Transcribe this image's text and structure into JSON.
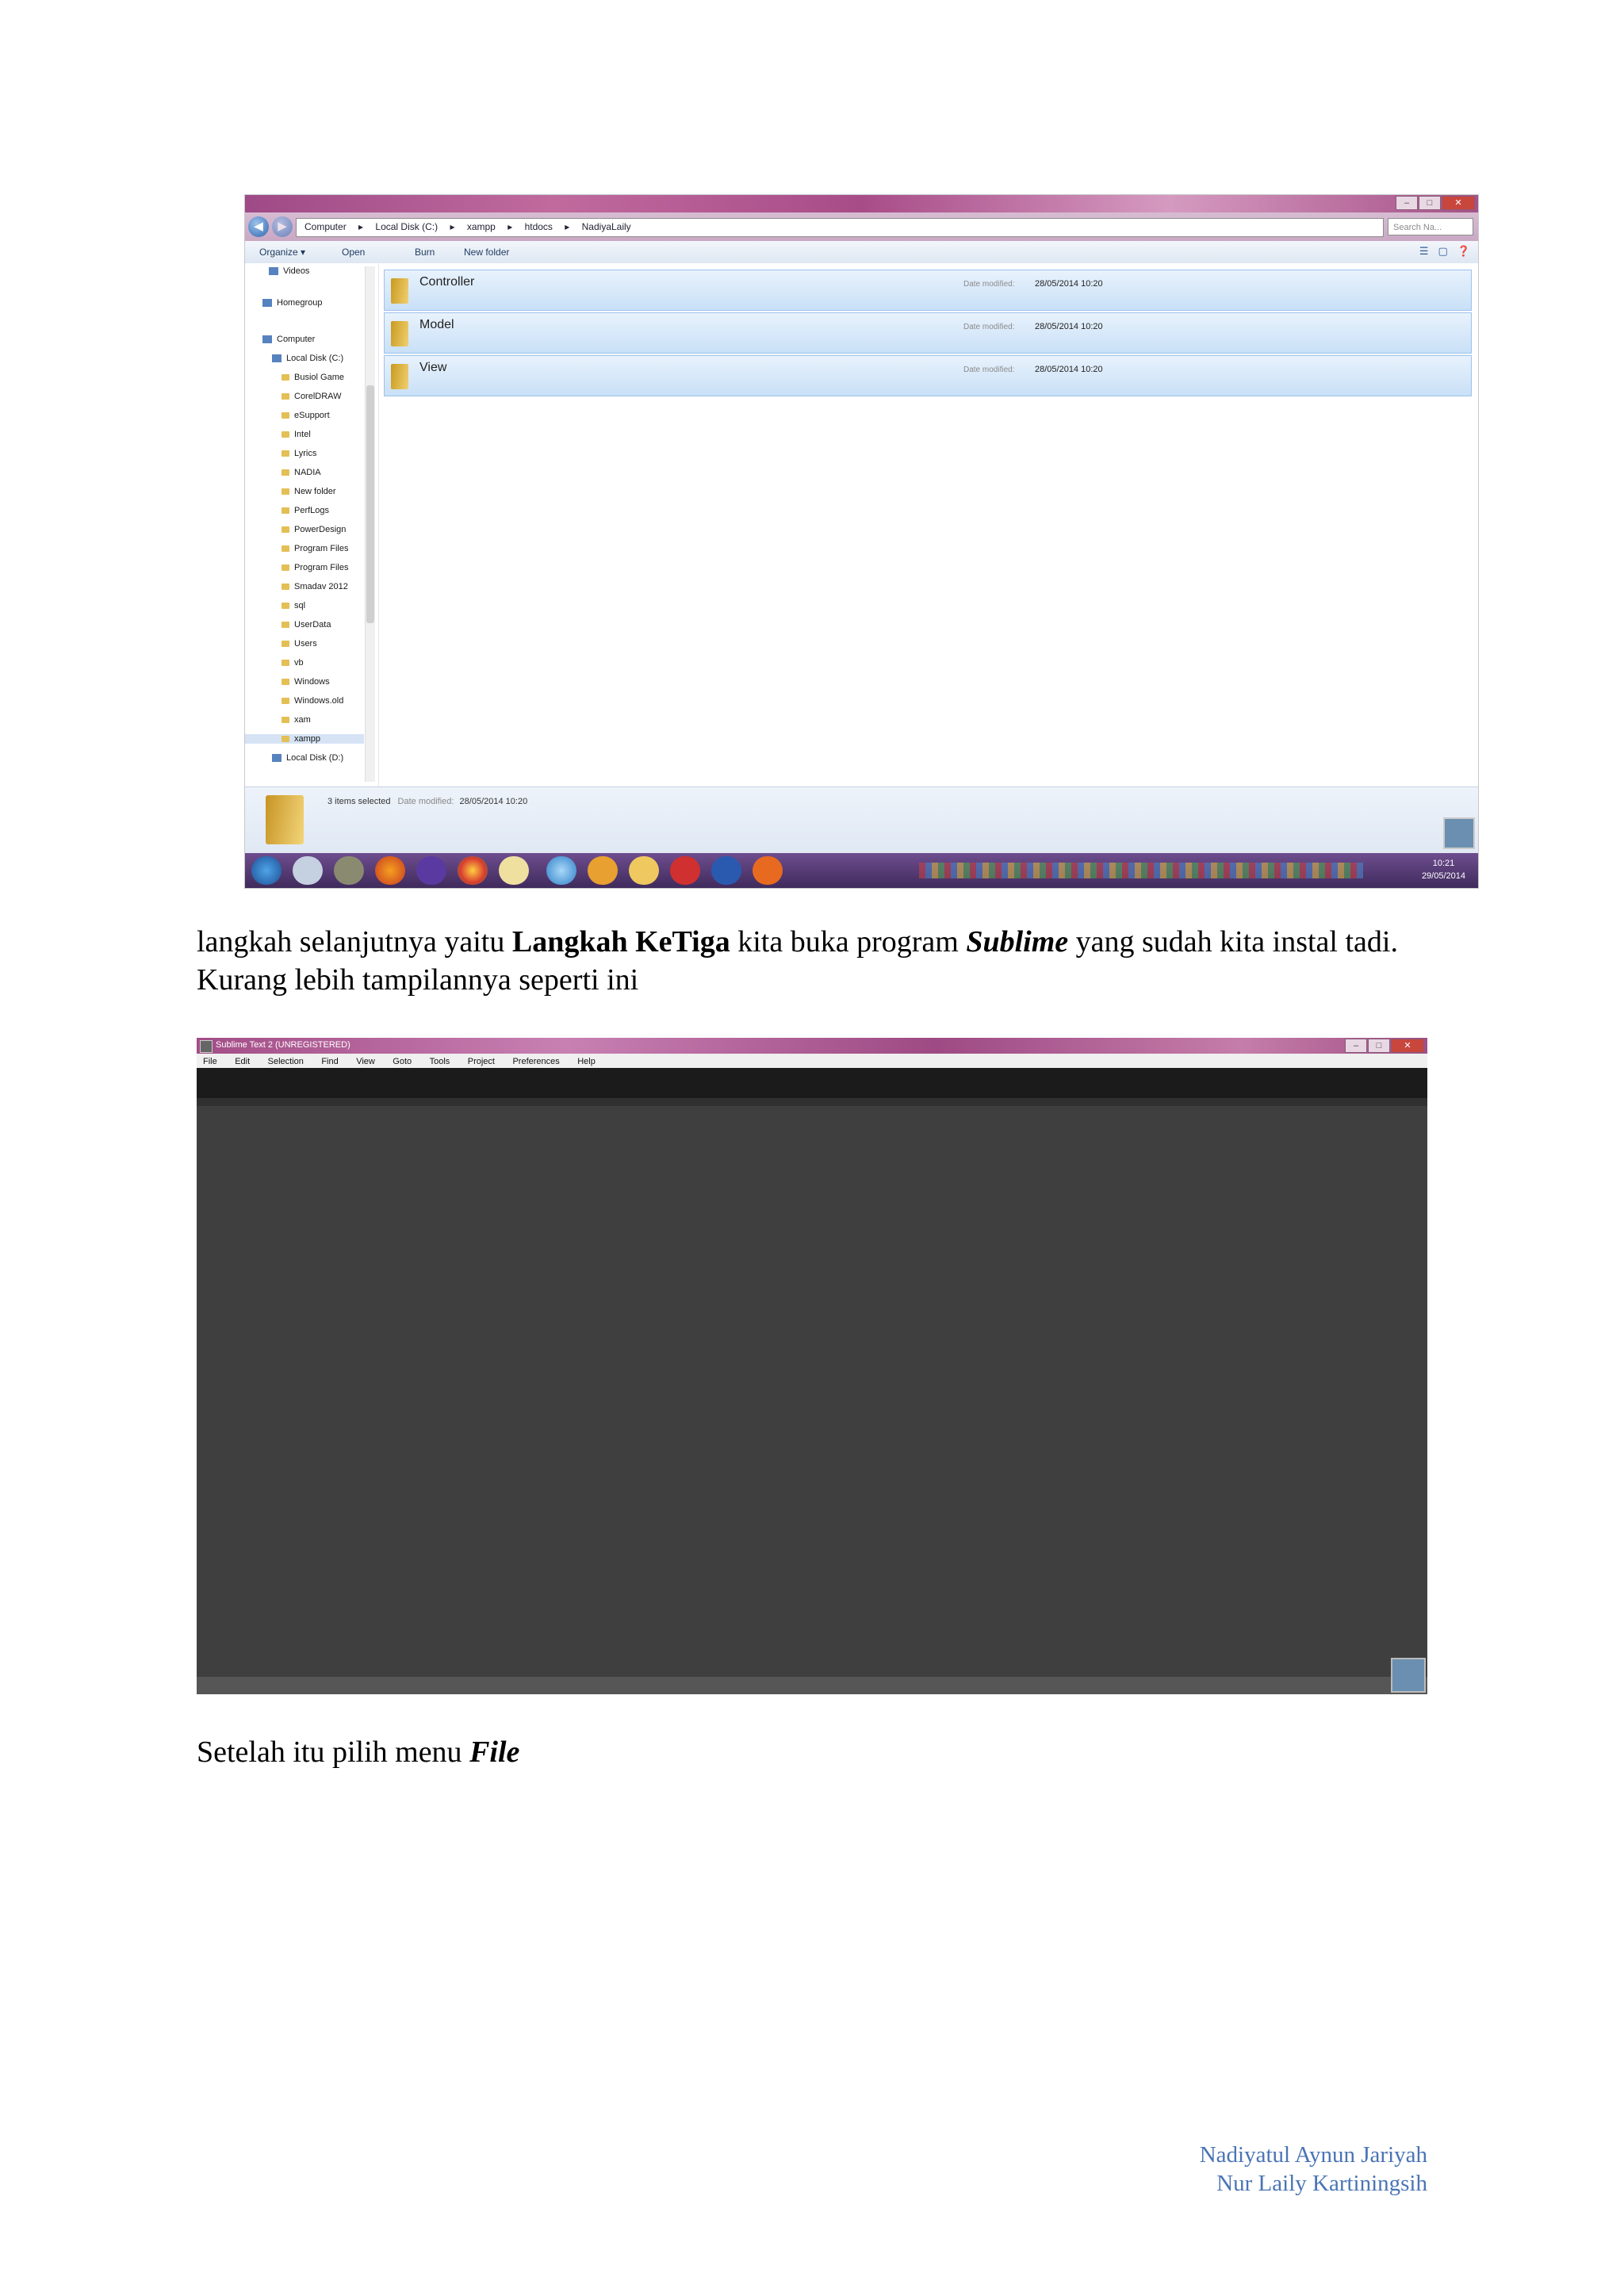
{
  "explorer": {
    "breadcrumb": [
      "Computer",
      "Local Disk (C:)",
      "xampp",
      "htdocs",
      "NadiyaLaily"
    ],
    "search_placeholder": "Search Na...",
    "toolbar": {
      "organize": "Organize ▾",
      "open": "Open",
      "burn": "Burn",
      "new_folder": "New folder"
    },
    "nav": {
      "videos": "Videos",
      "homegroup": "Homegroup",
      "computer": "Computer",
      "local_disk_c": "Local Disk (C:)",
      "folders": [
        "Busiol Game",
        "CorelDRAW",
        "eSupport",
        "Intel",
        "Lyrics",
        "NADIA",
        "New folder",
        "PerfLogs",
        "PowerDesign",
        "Program Files",
        "Program Files",
        "Smadav 2012",
        "sql",
        "UserData",
        "Users",
        "vb",
        "Windows",
        "Windows.old",
        "xam",
        "xampp"
      ],
      "local_disk_d": "Local Disk (D:)"
    },
    "files": [
      {
        "name": "Controller",
        "date_label": "Date modified:",
        "date": "28/05/2014 10:20"
      },
      {
        "name": "Model",
        "date_label": "Date modified:",
        "date": "28/05/2014 10:20"
      },
      {
        "name": "View",
        "date_label": "Date modified:",
        "date": "28/05/2014 10:20"
      }
    ],
    "details": {
      "selected": "3 items selected",
      "date_label": "Date modified:",
      "date": "28/05/2014 10:20"
    },
    "clock": {
      "time": "10:21",
      "date": "29/05/2014"
    }
  },
  "paragraph1": {
    "t1": "langkah selanjutnya yaitu ",
    "t2": "Langkah KeTiga",
    "t3": " kita buka program ",
    "t4": "Sublime",
    "t5": " yang sudah kita instal tadi. Kurang lebih tampilannya seperti ini"
  },
  "sublime": {
    "title": "Sublime Text 2 (UNREGISTERED)",
    "menu": [
      "File",
      "Edit",
      "Selection",
      "Find",
      "View",
      "Goto",
      "Tools",
      "Project",
      "Preferences",
      "Help"
    ]
  },
  "paragraph2": {
    "t1": "Setelah itu pilih menu ",
    "t2": "File"
  },
  "footer": {
    "line1": "Nadiyatul Aynun Jariyah",
    "line2": "Nur Laily Kartiningsih"
  },
  "colors": {
    "footer_text": "#4a74b5",
    "explorer_title": "#a84c88",
    "sublime_bg": "#3f3f3f"
  }
}
